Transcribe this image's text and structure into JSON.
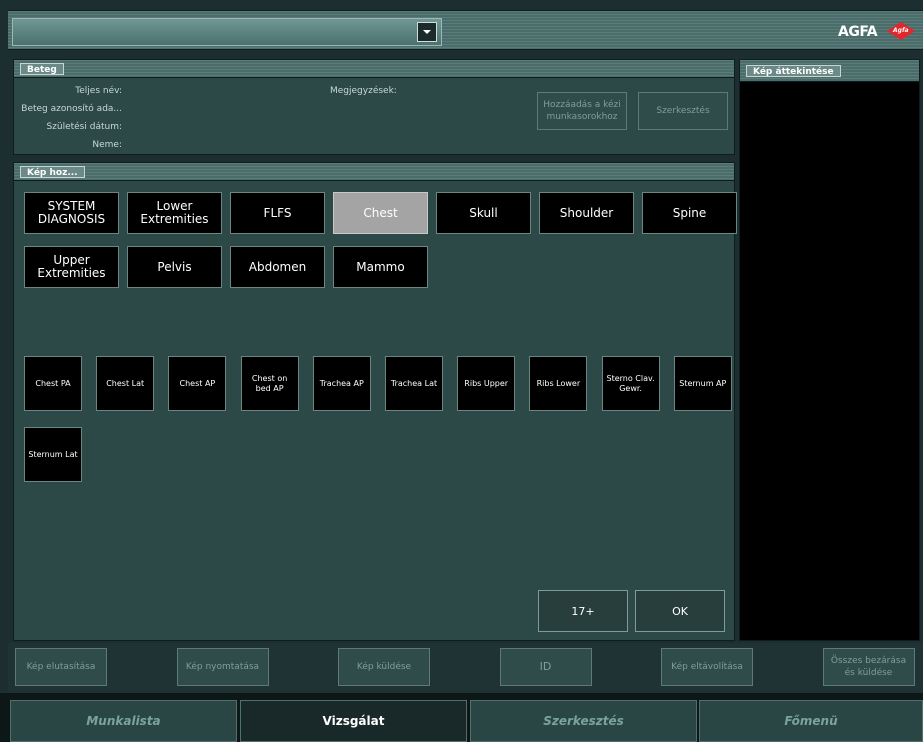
{
  "logo": {
    "text": "AGFA",
    "mark_text": "Agfa",
    "mark_color": "#e3262b"
  },
  "top_selector": {
    "value": ""
  },
  "patient": {
    "section_label": "Beteg",
    "fields": [
      {
        "label": "Teljes név:",
        "value": ""
      },
      {
        "label": "Beteg azonosító ada...",
        "value": ""
      },
      {
        "label": "Születési dátum:",
        "value": ""
      },
      {
        "label": "Neme:",
        "value": ""
      }
    ],
    "notes_label": "Megjegyzések:",
    "add_button": "Hozzáadás a kézi munkasorokhoz",
    "edit_button": "Szerkesztés"
  },
  "preview": {
    "section_label": "Kép áttekintése"
  },
  "exam": {
    "section_label": "Kép hoz...",
    "categories": [
      {
        "label": "SYSTEM DIAGNOSIS",
        "selected": false
      },
      {
        "label": "Lower Extremities",
        "selected": false
      },
      {
        "label": "FLFS",
        "selected": false
      },
      {
        "label": "Chest",
        "selected": true
      },
      {
        "label": "Skull",
        "selected": false
      },
      {
        "label": "Shoulder",
        "selected": false
      },
      {
        "label": "Spine",
        "selected": false
      },
      {
        "label": "Upper Extremities",
        "selected": false
      },
      {
        "label": "Pelvis",
        "selected": false
      },
      {
        "label": "Abdomen",
        "selected": false
      },
      {
        "label": "Mammo",
        "selected": false
      }
    ],
    "views": [
      "Chest PA",
      "Chest Lat",
      "Chest AP",
      "Chest on bed AP",
      "Trachea AP",
      "Trachea Lat",
      "Ribs Upper",
      "Ribs Lower",
      "Sterno Clav. Gewr.",
      "Sternum AP",
      "Sternum Lat"
    ],
    "age_button": "17+",
    "ok_button": "OK"
  },
  "actions": [
    "Kép elutasítása",
    "Kép nyomtatása",
    "Kép küldése",
    "ID",
    "Kép eltávolítása",
    "Összes bezárása és küldése"
  ],
  "tabs": [
    {
      "label": "Munkalista",
      "active": false
    },
    {
      "label": "Vizsgálat",
      "active": true
    },
    {
      "label": "Szerkesztés",
      "active": false
    },
    {
      "label": "Főmenü",
      "active": false
    }
  ]
}
